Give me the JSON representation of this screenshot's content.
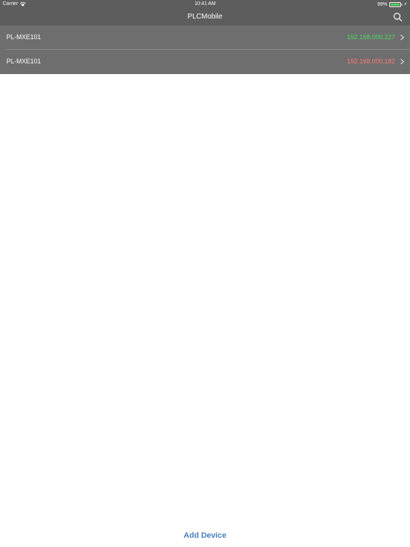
{
  "status_bar": {
    "carrier": "Carrier",
    "time": "10:41 AM",
    "battery": "99%"
  },
  "nav": {
    "title": "PLCMobile",
    "search_icon": "search-icon"
  },
  "devices": [
    {
      "name": "PL-MXE101",
      "ip": "192.168.000.227",
      "ip_color": "#4cd964"
    },
    {
      "name": "PL-MXE101",
      "ip": "192.168.000.182",
      "ip_color": "#ff7a7a"
    }
  ],
  "footer": {
    "add_device_label": "Add Device"
  },
  "colors": {
    "bar_bg": "#5d5d5d",
    "list_bg": "#6e6e6e",
    "accent": "#4a7fc1"
  }
}
